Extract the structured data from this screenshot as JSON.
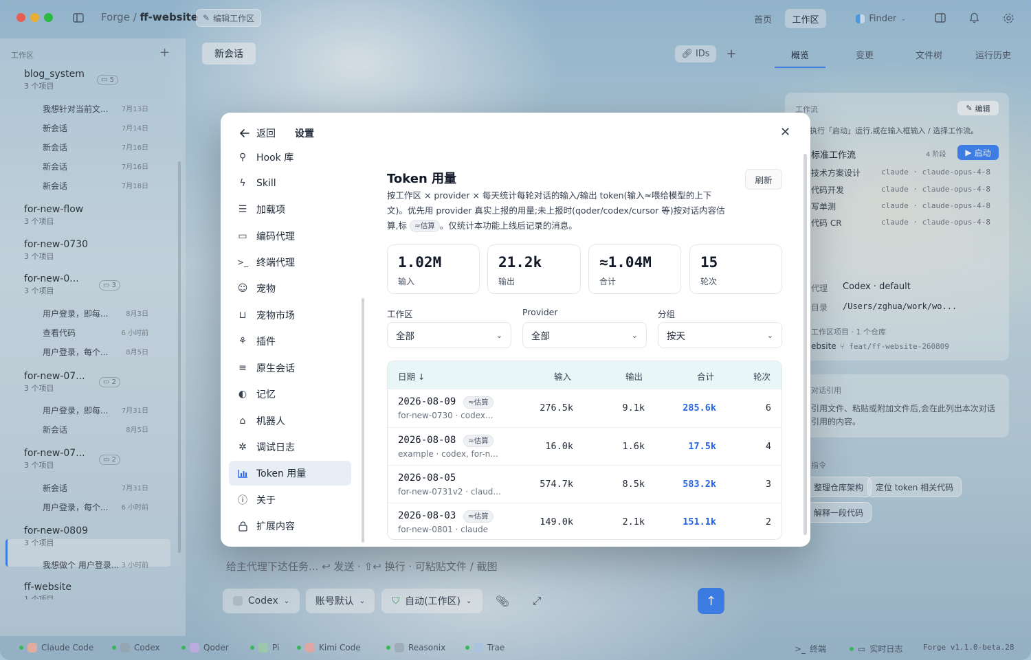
{
  "titlebar": {
    "crumb_parent": "Forge /",
    "crumb_current": "ff-website",
    "edit_workspace": "编辑工作区",
    "nav_home": "首页",
    "nav_workspace": "工作区",
    "finder": "Finder"
  },
  "sidebar": {
    "header": "工作区",
    "workspaces": [
      {
        "name": "blog_system",
        "sub": "3 个项目",
        "badge": "5",
        "sessions": [
          {
            "title": "我想针对当前文...",
            "time": "7月13日"
          },
          {
            "title": "新会话",
            "time": "7月14日"
          },
          {
            "title": "新会话",
            "time": "7月16日"
          },
          {
            "title": "新会话",
            "time": "7月16日"
          },
          {
            "title": "新会话",
            "time": "7月18日"
          }
        ]
      },
      {
        "name": "for-new-flow",
        "sub": "3 个项目"
      },
      {
        "name": "for-new-0730",
        "sub": "3 个项目"
      },
      {
        "name": "for-new-0...",
        "sub": "3 个项目",
        "badge": "3",
        "sessions": [
          {
            "title": "用户登录，即每...",
            "time": "8月3日"
          },
          {
            "title": "查看代码",
            "time": "6 小时前"
          },
          {
            "title": "用户登录，每个...",
            "time": "8月5日"
          }
        ]
      },
      {
        "name": "for-new-07...",
        "sub": "3 个项目",
        "badge": "2",
        "sessions": [
          {
            "title": "用户登录，即每...",
            "time": "7月31日"
          },
          {
            "title": "新会话",
            "time": "8月5日"
          }
        ]
      },
      {
        "name": "for-new-07...",
        "sub": "3 个项目",
        "badge": "2",
        "sessions": [
          {
            "title": "新会话",
            "time": "7月31日"
          },
          {
            "title": "用户登录，每个...",
            "time": "6 小时前"
          }
        ]
      },
      {
        "name": "for-new-0809",
        "sub": "3 个项目",
        "sessions": [
          {
            "title": "我想做个 用户登录...",
            "time": "3 小时前"
          }
        ]
      },
      {
        "name": "ff-website",
        "sub": "1 个项目"
      }
    ]
  },
  "main": {
    "tab_new": "新会话",
    "ids": "IDs",
    "composer_placeholder": "给主代理下达任务... ↩ 发送 · ⇧↩ 换行 · 可粘贴文件 / 截图",
    "agent": "Codex",
    "account": "账号默认",
    "mode": "自动(工作区)"
  },
  "right_panel": {
    "tabs": [
      "概览",
      "变更",
      "文件树",
      "运行历史"
    ],
    "workflow_label": "工作流",
    "edit": "编辑",
    "workflow_hint": "执行「启动」运行,或在输入框输入 / 选择工作流。",
    "workflow_name": "标准工作流",
    "stages": "4 阶段",
    "start": "启动",
    "steps": [
      {
        "name": "技术方案设计",
        "agent": "claude · claude-opus-4-8"
      },
      {
        "name": "代码开发",
        "agent": "claude · claude-opus-4-8"
      },
      {
        "name": "写单测",
        "agent": "claude · claude-opus-4-8"
      },
      {
        "name": "代码 CR",
        "agent": "claude · claude-opus-4-8"
      }
    ],
    "agent_label": "代理",
    "agent_value": "Codex · default",
    "dir_label": "目录",
    "dir_value": "/Users/zghua/work/wo...",
    "project_note": "工作区项目 · 1 个仓库",
    "repo": "ebsite",
    "branch": "feat/ff-website-260809",
    "ref_title": "对话引用",
    "ref_desc": "引用文件、粘贴或附加文件后,会在此列出本次对话引用的内容。",
    "cmd_title": "指令",
    "chips": [
      "整理仓库架构",
      "定位 token 相关代码",
      "解释一段代码"
    ]
  },
  "statusbar": {
    "agents": [
      "Claude Code",
      "Codex",
      "Qoder",
      "Pi",
      "Kimi Code",
      "Reasonix",
      "Trae"
    ],
    "terminal": "终端",
    "live_log": "实时日志",
    "version": "Forge v1.1.0-beta.28"
  },
  "modal": {
    "back": "返回",
    "title": "设置",
    "nav": [
      {
        "label": "Hook 库",
        "icon": "hook-icon"
      },
      {
        "label": "Skill",
        "icon": "bolt-icon"
      },
      {
        "label": "加载项",
        "icon": "sliders-icon"
      },
      {
        "label": "编码代理",
        "icon": "code-window-icon"
      },
      {
        "label": "终端代理",
        "icon": "terminal-icon"
      },
      {
        "label": "宠物",
        "icon": "pet-icon"
      },
      {
        "label": "宠物市场",
        "icon": "shopping-bag-icon"
      },
      {
        "label": "插件",
        "icon": "plugin-icon"
      },
      {
        "label": "原生会话",
        "icon": "list-icon"
      },
      {
        "label": "记忆",
        "icon": "memory-icon"
      },
      {
        "label": "机器人",
        "icon": "robot-icon"
      },
      {
        "label": "调试日志",
        "icon": "bug-icon"
      },
      {
        "label": "Token 用量",
        "icon": "bar-chart-icon"
      },
      {
        "label": "关于",
        "icon": "info-icon"
      },
      {
        "label": "扩展内容",
        "icon": "lock-icon"
      }
    ],
    "active_nav": "Token 用量",
    "content": {
      "title": "Token 用量",
      "desc_1": "按工作区 × provider × 每天统计每轮对话的输入/输出 token(输入≈喂给模型的上下文)。优先用 provider 真实上报的用量;未上报时(qoder/codex/cursor 等)按对话内容估算,标",
      "est_tag": "≈估算",
      "desc_2": "。仅统计本功能上线后记录的消息。",
      "refresh": "刷新",
      "stats": [
        {
          "value": "1.02M",
          "label": "输入"
        },
        {
          "value": "21.2k",
          "label": "输出"
        },
        {
          "value": "≈1.04M",
          "label": "合计"
        },
        {
          "value": "15",
          "label": "轮次"
        }
      ],
      "filters": [
        {
          "label": "工作区",
          "value": "全部"
        },
        {
          "label": "Provider",
          "value": "全部"
        },
        {
          "label": "分组",
          "value": "按天"
        }
      ],
      "table": {
        "headers": [
          "日期 ↓",
          "输入",
          "输出",
          "合计",
          "轮次"
        ],
        "rows": [
          {
            "date": "2026-08-09",
            "estimated": true,
            "sub": "for-new-0730 · codex...",
            "input": "276.5k",
            "output": "9.1k",
            "total": "285.6k",
            "turns": "6"
          },
          {
            "date": "2026-08-08",
            "estimated": true,
            "sub": "example · codex, for-n...",
            "input": "16.0k",
            "output": "1.6k",
            "total": "17.5k",
            "turns": "4"
          },
          {
            "date": "2026-08-05",
            "estimated": false,
            "sub": "for-new-0731v2 · claud...",
            "input": "574.7k",
            "output": "8.5k",
            "total": "583.2k",
            "turns": "3"
          },
          {
            "date": "2026-08-03",
            "estimated": true,
            "sub": "for-new-0801 · claude",
            "input": "149.0k",
            "output": "2.1k",
            "total": "151.1k",
            "turns": "2"
          }
        ]
      }
    }
  }
}
